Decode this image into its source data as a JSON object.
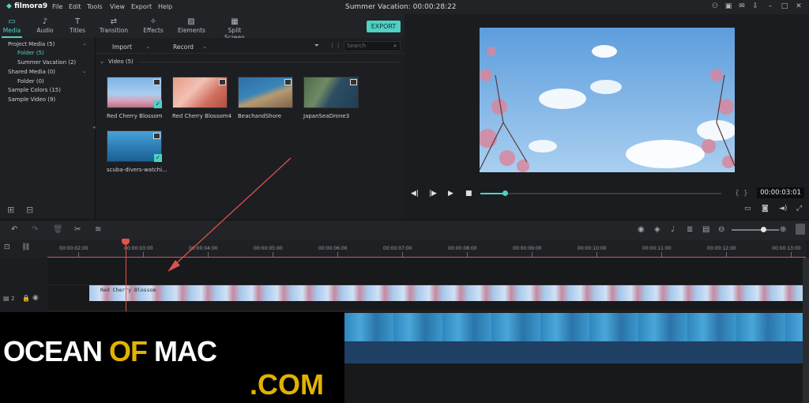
{
  "app": {
    "name": "filmora9",
    "title": "Summer Vacation:  00:00:28:22"
  },
  "menu": [
    "File",
    "Edit",
    "Tools",
    "View",
    "Export",
    "Help"
  ],
  "tabs": [
    {
      "label": "Media",
      "icon": "folder-icon"
    },
    {
      "label": "Audio",
      "icon": "music-note-icon"
    },
    {
      "label": "Titles",
      "icon": "text-icon"
    },
    {
      "label": "Transition",
      "icon": "transition-icon"
    },
    {
      "label": "Effects",
      "icon": "effects-icon"
    },
    {
      "label": "Elements",
      "icon": "image-icon"
    },
    {
      "label": "Split Screen",
      "icon": "split-screen-icon"
    }
  ],
  "export_label": "EXPORT",
  "tree": {
    "project_media": "Project Media (5)",
    "folder": "Folder (5)",
    "summer": "Summer Vacation (2)",
    "shared_media": "Shared Media (0)",
    "shared_folder": "Folder (0)",
    "sample_colors": "Sample Colors (15)",
    "sample_video": "Sample Video (9)"
  },
  "media_toolbar": {
    "import": "Import",
    "record": "Record",
    "search_placeholder": "Search"
  },
  "media": {
    "section": "Video (5)",
    "items": [
      {
        "label": "Red Cherry Blossom"
      },
      {
        "label": "Red Cherry Blossom4"
      },
      {
        "label": "BeachandShore"
      },
      {
        "label": "JapanSeaDrone3"
      },
      {
        "label": "scuba-divers-watchi..."
      }
    ]
  },
  "preview": {
    "timecode": "00:00:03:01",
    "progress": 0.1
  },
  "ruler": [
    "00:00:02:00",
    "00:00:03:00",
    "00:00:04:00",
    "00:00:05:00",
    "00:00:06:00",
    "00:00:07:00",
    "00:00:08:00",
    "00:00:09:00",
    "00:00:10:00",
    "00:00:11:00",
    "00:00:12:00",
    "00:00:13:00"
  ],
  "tracks": {
    "video2_label": "2",
    "clip_label": "Red Cherry Blossom"
  },
  "watermark": {
    "line1_a": "OCEAN",
    "line1_b": "OF",
    "line1_c": "MAC",
    "line2": ".COM"
  }
}
